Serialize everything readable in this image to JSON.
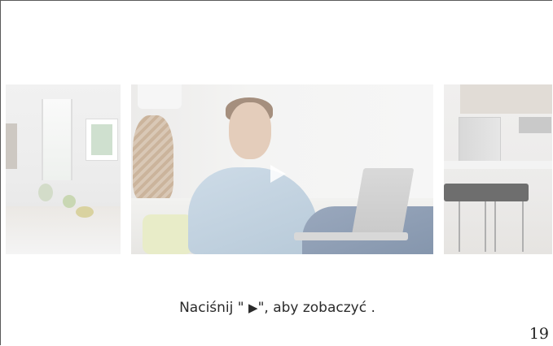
{
  "gallery": {
    "items": [
      {
        "name": "kitchen-photo-left"
      },
      {
        "name": "man-with-laptop-video"
      },
      {
        "name": "kitchen-photo-right"
      }
    ],
    "play_icon": "play-triangle-icon"
  },
  "instruction": {
    "before": "Naciśnij \" ",
    "icon": "play-icon",
    "glyph": "▶",
    "after": "\", aby zobaczyć ."
  },
  "page": {
    "number": "19"
  }
}
